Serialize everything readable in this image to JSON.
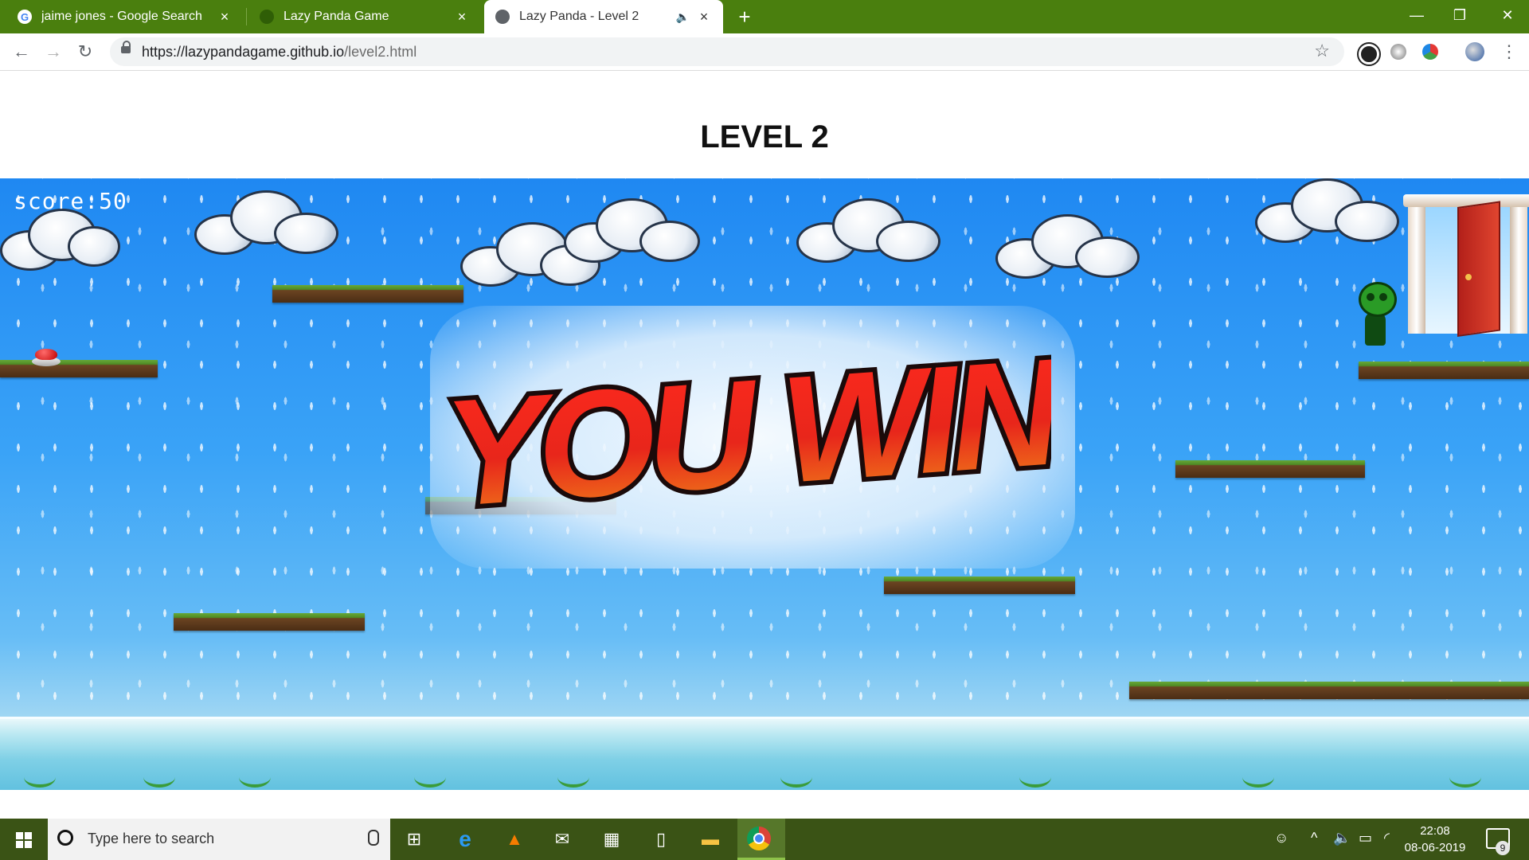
{
  "browser": {
    "tabs": [
      {
        "title": "jaime jones - Google Search",
        "close": "×"
      },
      {
        "title": "Lazy Panda Game",
        "close": "×"
      },
      {
        "title": "Lazy Panda - Level 2",
        "close": "×"
      }
    ],
    "new_tab": "+",
    "window_controls": {
      "minimize": "—",
      "maximize": "❐",
      "close": "✕"
    },
    "nav": {
      "back": "←",
      "forward": "→",
      "reload": "↻"
    },
    "url": {
      "host": "https://lazypandagame.github.io",
      "path": "/level2.html"
    },
    "bookmark": "☆",
    "menu": "⋮"
  },
  "page": {
    "heading": "LEVEL 2",
    "game": {
      "score_text": "score:50",
      "banner": "YOU WIN"
    }
  },
  "taskbar": {
    "search_placeholder": "Type here to search",
    "time": "22:08",
    "date": "08-06-2019",
    "notification_count": "9"
  },
  "colors": {
    "chrome_frame": "#4a7f0e",
    "taskbar": "#3a5315",
    "sky": "#1f88f2",
    "banner_red": "#e8261b"
  },
  "icons": [
    "google-icon",
    "globe-icon",
    "speaker-icon",
    "lock-icon",
    "star-icon",
    "windows-icon",
    "cortana-icon",
    "edge-icon",
    "vlc-icon",
    "mail-icon",
    "store-icon",
    "files-icon",
    "explorer-icon",
    "chrome-icon"
  ]
}
